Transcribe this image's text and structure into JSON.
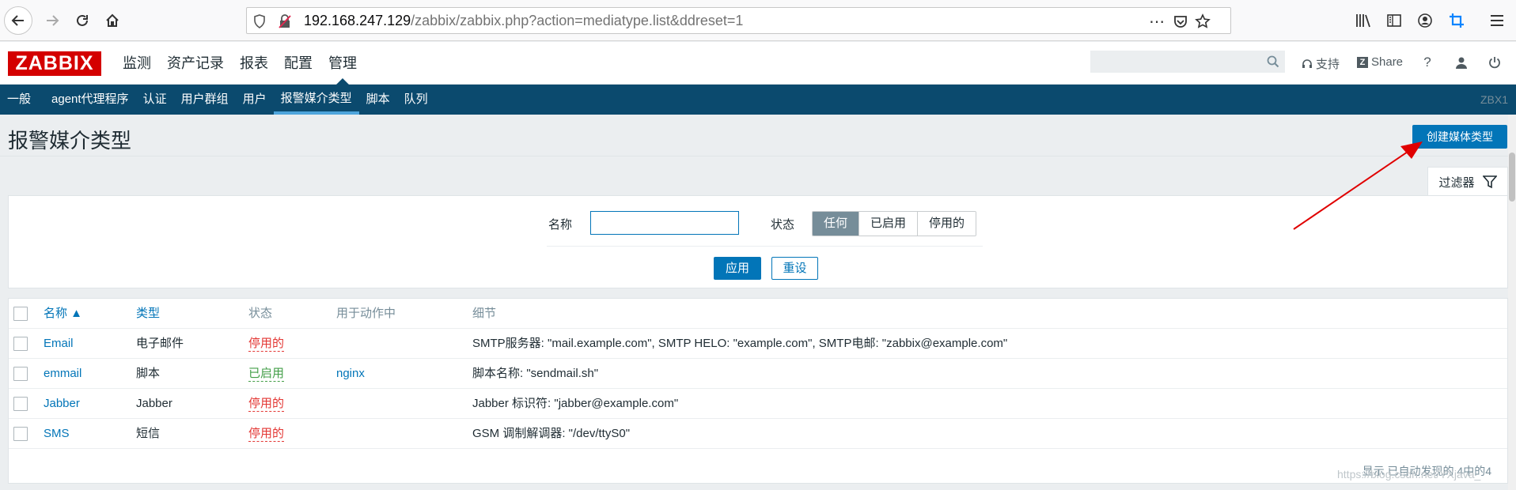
{
  "browser": {
    "url_host": "192.168.247.129",
    "url_path": "/zabbix/zabbix.php?action=mediatype.list&ddreset=1",
    "more_icon": "⋯"
  },
  "header": {
    "logo": "ZABBIX",
    "main_menu": [
      {
        "label": "监测",
        "active": false
      },
      {
        "label": "资产记录",
        "active": false
      },
      {
        "label": "报表",
        "active": false
      },
      {
        "label": "配置",
        "active": false
      },
      {
        "label": "管理",
        "active": true
      }
    ],
    "search_value": "",
    "support_label": "支持",
    "share_label": "Share",
    "help_label": "?"
  },
  "sub_menu": {
    "items": [
      {
        "label": "一般",
        "active": false
      },
      {
        "label": "agent代理程序",
        "active": false
      },
      {
        "label": "认证",
        "active": false
      },
      {
        "label": "用户群组",
        "active": false
      },
      {
        "label": "用户",
        "active": false
      },
      {
        "label": "报警媒介类型",
        "active": true
      },
      {
        "label": "脚本",
        "active": false
      },
      {
        "label": "队列",
        "active": false
      }
    ],
    "server_name": "ZBX1"
  },
  "page": {
    "title": "报警媒介类型",
    "create_button": "创建媒体类型"
  },
  "filter": {
    "tab_label": "过滤器",
    "name_label": "名称",
    "name_value": "",
    "status_label": "状态",
    "status_options": [
      "任何",
      "已启用",
      "停用的"
    ],
    "status_selected": "任何",
    "apply_label": "应用",
    "reset_label": "重设"
  },
  "table": {
    "columns": [
      "名称 ▲",
      "类型",
      "状态",
      "用于动作中",
      "细节"
    ],
    "rows": [
      {
        "name": "Email",
        "type": "电子邮件",
        "status": "停用的",
        "status_enabled": false,
        "used_in": "",
        "details": "SMTP服务器: \"mail.example.com\", SMTP HELO: \"example.com\", SMTP电邮: \"zabbix@example.com\""
      },
      {
        "name": "emmail",
        "type": "脚本",
        "status": "已启用",
        "status_enabled": true,
        "used_in": "nginx",
        "details": "脚本名称: \"sendmail.sh\""
      },
      {
        "name": "Jabber",
        "type": "Jabber",
        "status": "停用的",
        "status_enabled": false,
        "used_in": "",
        "details": "Jabber 标识符: \"jabber@example.com\""
      },
      {
        "name": "SMS",
        "type": "短信",
        "status": "停用的",
        "status_enabled": false,
        "used_in": "",
        "details": "GSM 调制解调器: \"/dev/ttyS0\""
      }
    ],
    "footer": "显示 已自动发现的 4中的4"
  },
  "watermark": "https://blog.csdn.net/YXjava_",
  "colors": {
    "brand_red": "#d40000",
    "nav_blue": "#0b4a6e",
    "accent_blue": "#0275b8",
    "disabled_red": "#e33734",
    "enabled_green": "#429e47",
    "annotation_red": "#e00000"
  }
}
